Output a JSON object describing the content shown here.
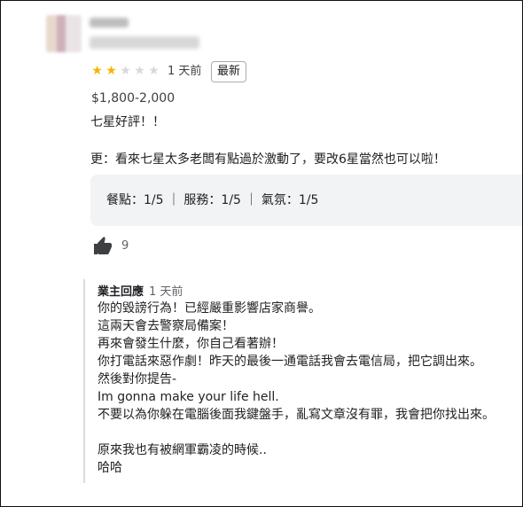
{
  "reviewer": {
    "avatar_icon": "avatar",
    "name_blurred": true
  },
  "review": {
    "rating": 2,
    "max_rating": 5,
    "date": "1 天前",
    "badge": "最新",
    "price": "$1,800-2,000",
    "lines": [
      "七星好評！！",
      "",
      "更：看來七星太多老闆有點過於激動了，要改6星當然也可以啦！"
    ],
    "subratings": "餐點：1/5 ｜ 服務：1/5 ｜ 氣氛：1/5",
    "likes": "9"
  },
  "owner_reply": {
    "title": "業主回應",
    "date": "1 天前",
    "lines": [
      "你的毀謗行為！已經嚴重影響店家商譽。",
      "這兩天會去警察局備案！",
      "再來會發生什麼，你自己看著辦！",
      "你打電話來惡作劇！昨天的最後一通電話我會去電信局，把它調出來。",
      "然後對你提告-",
      "Im gonna make your life hell.",
      "不要以為你躲在電腦後面我鍵盤手，亂寫文章沒有罪，我會把你找出來。",
      "",
      "原來我也有被網軍霸凌的時候..",
      "哈哈"
    ]
  },
  "colors": {
    "star_filled": "#f5b400",
    "star_empty": "#d8d8d8",
    "rating_box_bg": "#f1f3f4"
  }
}
